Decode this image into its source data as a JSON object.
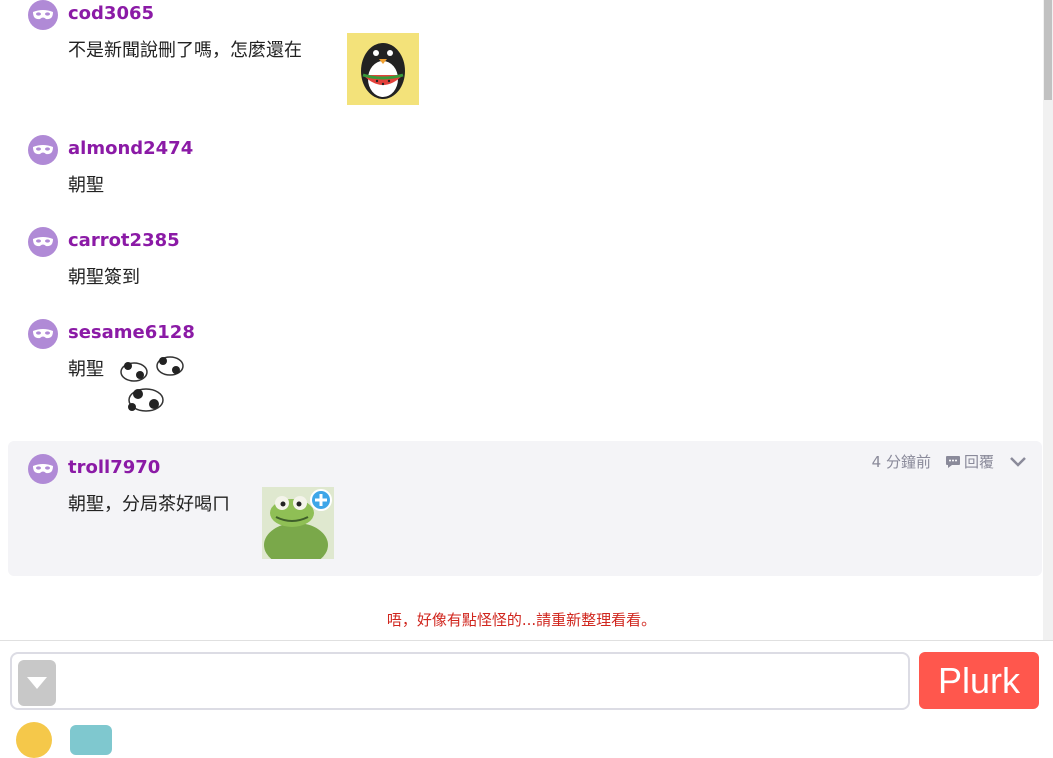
{
  "responses": [
    {
      "user": "cod3065",
      "text": "不是新聞說刪了嗎，怎麼還在",
      "emoticon": "penguin-watermelon-emoticon"
    },
    {
      "user": "almond2474",
      "text": "朝聖"
    },
    {
      "user": "carrot2385",
      "text": "朝聖簽到"
    },
    {
      "user": "sesame6128",
      "text": "朝聖",
      "emoticon": "panda-emoticon"
    },
    {
      "user": "troll7970",
      "text": "朝聖，分局茶好喝ㄇ",
      "emoticon": "kermit-frog-emoticon",
      "time": "4 分鐘前",
      "reply_label": "回覆"
    }
  ],
  "error_message": "唔，好像有點怪怪的...請重新整理看看。",
  "composer": {
    "placeholder": "",
    "submit_label": "Plurk"
  },
  "colors": {
    "username": "#8b1aa6",
    "submit": "#ff574d",
    "error": "#d0261e",
    "avatar": "#b08ad6"
  }
}
